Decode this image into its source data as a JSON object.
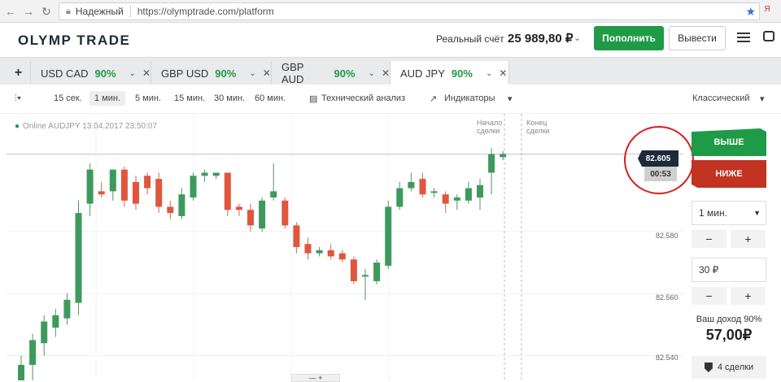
{
  "browser": {
    "secure_label": "Надежный",
    "url": "https://olymptrade.com/platform",
    "ext_label": "Я"
  },
  "header": {
    "logo": "OLYMP TRADE",
    "account_label": "Реальный счёт",
    "account_balance": "25 989,80 ₽",
    "deposit_label": "Пополнить",
    "withdraw_label": "Вывести"
  },
  "tabs": [
    {
      "name": "USD CAD",
      "pct": "90%"
    },
    {
      "name": "GBP USD",
      "pct": "90%"
    },
    {
      "name": "GBP AUD",
      "pct": "90%"
    },
    {
      "name": "AUD JPY",
      "pct": "90%"
    }
  ],
  "toolbar": {
    "timeframes": [
      "15 сек.",
      "1 мин.",
      "5 мин.",
      "15 мин.",
      "30 мин.",
      "60 мин."
    ],
    "tech_analysis": "Технический анализ",
    "indicators": "Индикаторы",
    "view_mode": "Классический"
  },
  "chart": {
    "online_text": "Online AUDJPY 13.04.2017 23:50:07",
    "start_label_1": "Начало",
    "start_label_2": "сделки",
    "end_label_1": "Конец",
    "end_label_2": "сделки",
    "current_price": "82.605",
    "timer": "00:53",
    "axis_labels": [
      "82.580",
      "82.560",
      "82.540"
    ]
  },
  "chart_data": {
    "type": "candlestick",
    "ylim": [
      82.532,
      82.618
    ],
    "y_ticks": [
      82.58,
      82.56,
      82.54
    ],
    "candles": [
      {
        "o": 82.532,
        "c": 82.537,
        "h": 82.54,
        "l": 82.528
      },
      {
        "o": 82.537,
        "c": 82.545,
        "h": 82.547,
        "l": 82.532
      },
      {
        "o": 82.544,
        "c": 82.551,
        "h": 82.553,
        "l": 82.54
      },
      {
        "o": 82.549,
        "c": 82.553,
        "h": 82.555,
        "l": 82.546
      },
      {
        "o": 82.552,
        "c": 82.558,
        "h": 82.56,
        "l": 82.55
      },
      {
        "o": 82.557,
        "c": 82.586,
        "h": 82.59,
        "l": 82.553
      },
      {
        "o": 82.589,
        "c": 82.6,
        "h": 82.602,
        "l": 82.585
      },
      {
        "o": 82.593,
        "c": 82.592,
        "h": 82.596,
        "l": 82.591
      },
      {
        "o": 82.593,
        "c": 82.6,
        "h": 82.6,
        "l": 82.59
      },
      {
        "o": 82.6,
        "c": 82.59,
        "h": 82.601,
        "l": 82.588
      },
      {
        "o": 82.596,
        "c": 82.589,
        "h": 82.598,
        "l": 82.587
      },
      {
        "o": 82.598,
        "c": 82.594,
        "h": 82.599,
        "l": 82.592
      },
      {
        "o": 82.597,
        "c": 82.588,
        "h": 82.599,
        "l": 82.586
      },
      {
        "o": 82.588,
        "c": 82.586,
        "h": 82.59,
        "l": 82.584
      },
      {
        "o": 82.585,
        "c": 82.592,
        "h": 82.594,
        "l": 82.584
      },
      {
        "o": 82.591,
        "c": 82.598,
        "h": 82.599,
        "l": 82.59
      },
      {
        "o": 82.598,
        "c": 82.599,
        "h": 82.6,
        "l": 82.596
      },
      {
        "o": 82.598,
        "c": 82.599,
        "h": 82.599,
        "l": 82.597
      },
      {
        "o": 82.599,
        "c": 82.587,
        "h": 82.599,
        "l": 82.585
      },
      {
        "o": 82.588,
        "c": 82.587,
        "h": 82.589,
        "l": 82.585
      },
      {
        "o": 82.587,
        "c": 82.582,
        "h": 82.589,
        "l": 82.58
      },
      {
        "o": 82.581,
        "c": 82.59,
        "h": 82.591,
        "l": 82.58
      },
      {
        "o": 82.591,
        "c": 82.593,
        "h": 82.602,
        "l": 82.59
      },
      {
        "o": 82.59,
        "c": 82.582,
        "h": 82.591,
        "l": 82.581
      },
      {
        "o": 82.582,
        "c": 82.575,
        "h": 82.583,
        "l": 82.573
      },
      {
        "o": 82.576,
        "c": 82.573,
        "h": 82.578,
        "l": 82.571
      },
      {
        "o": 82.573,
        "c": 82.574,
        "h": 82.575,
        "l": 82.572
      },
      {
        "o": 82.574,
        "c": 82.572,
        "h": 82.576,
        "l": 82.571
      },
      {
        "o": 82.573,
        "c": 82.571,
        "h": 82.574,
        "l": 82.57
      },
      {
        "o": 82.571,
        "c": 82.564,
        "h": 82.572,
        "l": 82.563
      },
      {
        "o": 82.566,
        "c": 82.566,
        "h": 82.568,
        "l": 82.558
      },
      {
        "o": 82.564,
        "c": 82.57,
        "h": 82.571,
        "l": 82.563
      },
      {
        "o": 82.569,
        "c": 82.588,
        "h": 82.59,
        "l": 82.568
      },
      {
        "o": 82.588,
        "c": 82.594,
        "h": 82.596,
        "l": 82.587
      },
      {
        "o": 82.594,
        "c": 82.596,
        "h": 82.599,
        "l": 82.593
      },
      {
        "o": 82.597,
        "c": 82.592,
        "h": 82.599,
        "l": 82.591
      },
      {
        "o": 82.593,
        "c": 82.593,
        "h": 82.594,
        "l": 82.591
      },
      {
        "o": 82.592,
        "c": 82.589,
        "h": 82.593,
        "l": 82.586
      },
      {
        "o": 82.59,
        "c": 82.591,
        "h": 82.592,
        "l": 82.587
      },
      {
        "o": 82.59,
        "c": 82.594,
        "h": 82.596,
        "l": 82.589
      },
      {
        "o": 82.591,
        "c": 82.595,
        "h": 82.597,
        "l": 82.587
      },
      {
        "o": 82.599,
        "c": 82.605,
        "h": 82.607,
        "l": 82.592
      },
      {
        "o": 82.604,
        "c": 82.605,
        "h": 82.606,
        "l": 82.603
      }
    ]
  },
  "panel": {
    "up_label": "ВЫШЕ",
    "down_label": "НИЖЕ",
    "duration": "1 мин.",
    "amount": "30 ₽",
    "minus": "−",
    "plus": "+",
    "income_label": "Ваш доход 90%",
    "income_value": "57,00₽",
    "deals_label": "4 сделки"
  },
  "colors": {
    "green": "#1f9b47",
    "red": "#c23322",
    "candle_up": "#3e9a5c",
    "candle_down": "#e0563d"
  }
}
